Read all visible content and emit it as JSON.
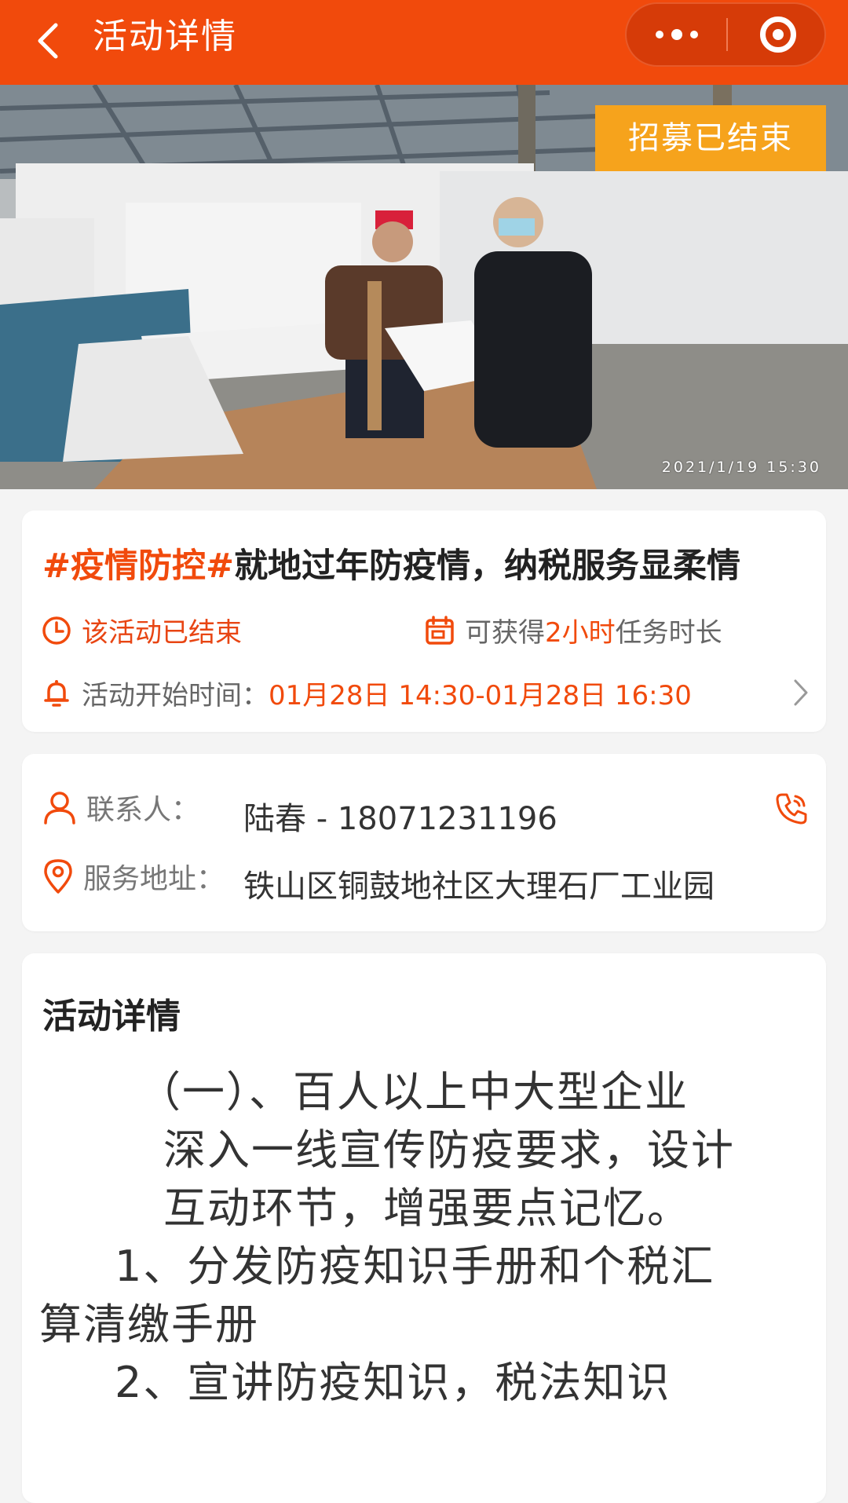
{
  "header": {
    "title": "活动详情",
    "icons": {
      "back": "chevron-left-icon",
      "more": "more-dots-icon",
      "close": "target-icon"
    }
  },
  "hero": {
    "badge": "招募已结束",
    "timestamp": "2021/1/19 15:30"
  },
  "activity": {
    "tag": "#疫情防控#",
    "title": "就地过年防疫情，纳税服务显柔情",
    "status": "该活动已结束",
    "duration_prefix": "可获得",
    "duration_value": "2小时",
    "duration_suffix": "任务时长",
    "start_label": "活动开始时间：",
    "start_value": "01月28日 14:30-01月28日 16:30"
  },
  "contact": {
    "contact_label": "联系人：",
    "contact_value": "陆春 - 18071231196",
    "address_label": "服务地址：",
    "address_value": "铁山区铜鼓地社区大理石厂工业园"
  },
  "details": {
    "heading": "活动详情",
    "lines": [
      "（一）、百人以上中大型企业",
      "深入一线宣传防疫要求，设计",
      "互动环节，增强要点记忆。",
      "1、分发防疫知识手册和个税汇",
      "算清缴手册",
      "2、宣讲防疫知识，税法知识"
    ]
  },
  "colors": {
    "brand": "#f14a0c",
    "badge": "#f6a31c",
    "text": "#333333",
    "muted": "#666666"
  }
}
